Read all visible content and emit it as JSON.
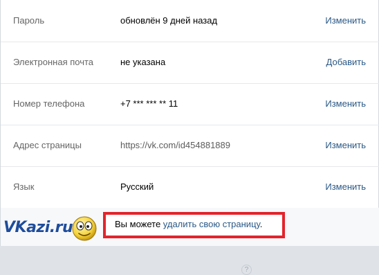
{
  "settings": {
    "rows": [
      {
        "label": "Пароль",
        "value": "обновлён 9 дней назад",
        "action": "Изменить"
      },
      {
        "label": "Электронная почта",
        "value": "не указана",
        "action": "Добавить"
      },
      {
        "label": "Номер телефона",
        "value": "+7 *** *** ** 11",
        "action": "Изменить"
      },
      {
        "label": "Адрес страницы",
        "value": "https://vk.com/id454881889",
        "action": "Изменить"
      },
      {
        "label": "Язык",
        "value": "Русский",
        "action": "Изменить"
      }
    ]
  },
  "delete_notice": {
    "prefix": "Вы можете ",
    "link": "удалить свою страницу",
    "suffix": "."
  },
  "watermark": {
    "text": "VKazi.ru"
  },
  "icons": {
    "help": "question-circle-icon",
    "smiley": "smiley-face-icon"
  },
  "colors": {
    "link": "#2a5885",
    "highlight": "#e3242b",
    "watermark": "#1e4d9c"
  }
}
